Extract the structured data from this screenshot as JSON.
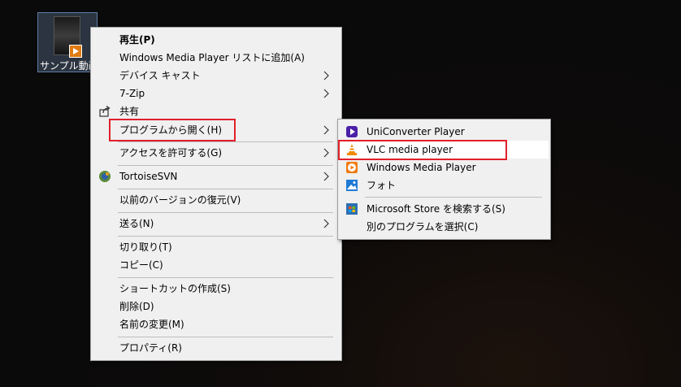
{
  "desktop": {
    "file_label": "サンプル動画"
  },
  "context_menu": {
    "items": [
      {
        "label": "再生(P)"
      },
      {
        "label": "Windows Media Player リストに追加(A)"
      },
      {
        "label": "デバイス キャスト"
      },
      {
        "label": "7-Zip"
      },
      {
        "label": "共有"
      },
      {
        "label": "プログラムから開く(H)"
      },
      {
        "label": "アクセスを許可する(G)"
      },
      {
        "label": "TortoiseSVN"
      },
      {
        "label": "以前のバージョンの復元(V)"
      },
      {
        "label": "送る(N)"
      },
      {
        "label": "切り取り(T)"
      },
      {
        "label": "コピー(C)"
      },
      {
        "label": "ショートカットの作成(S)"
      },
      {
        "label": "削除(D)"
      },
      {
        "label": "名前の変更(M)"
      },
      {
        "label": "プロパティ(R)"
      }
    ]
  },
  "open_with_menu": {
    "items": [
      {
        "label": "UniConverter Player"
      },
      {
        "label": "VLC media player"
      },
      {
        "label": "Windows Media Player"
      },
      {
        "label": "フォト"
      },
      {
        "label": "Microsoft Store を検索する(S)"
      },
      {
        "label": "別のプログラムを選択(C)"
      }
    ]
  },
  "colors": {
    "highlight_border": "#e0202a",
    "menu_background": "#f0f0f0"
  }
}
